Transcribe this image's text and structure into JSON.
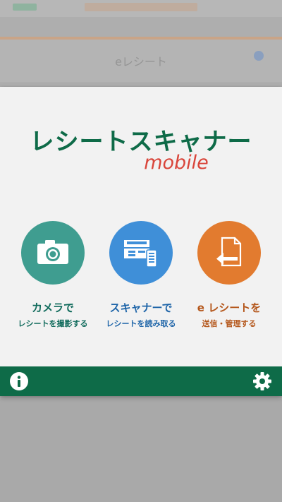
{
  "background": {
    "header_title": "eレシート"
  },
  "dialog": {
    "title": "レシートスキャナー",
    "subtitle": "mobile",
    "actions": [
      {
        "label": "カメラで",
        "sublabel": "レシートを撮影する",
        "icon": "camera-icon",
        "color": "#3f9d90"
      },
      {
        "label": "スキャナーで",
        "sublabel": "レシートを読み取る",
        "icon": "scanner-icon",
        "color": "#3f8fd8"
      },
      {
        "label": "e レシートを",
        "sublabel": "送信・管理する",
        "icon": "document-send-icon",
        "color": "#e27b2f"
      }
    ],
    "footer": {
      "info_icon": "info-icon",
      "settings_icon": "gear-icon",
      "color": "#0e6b48"
    }
  }
}
